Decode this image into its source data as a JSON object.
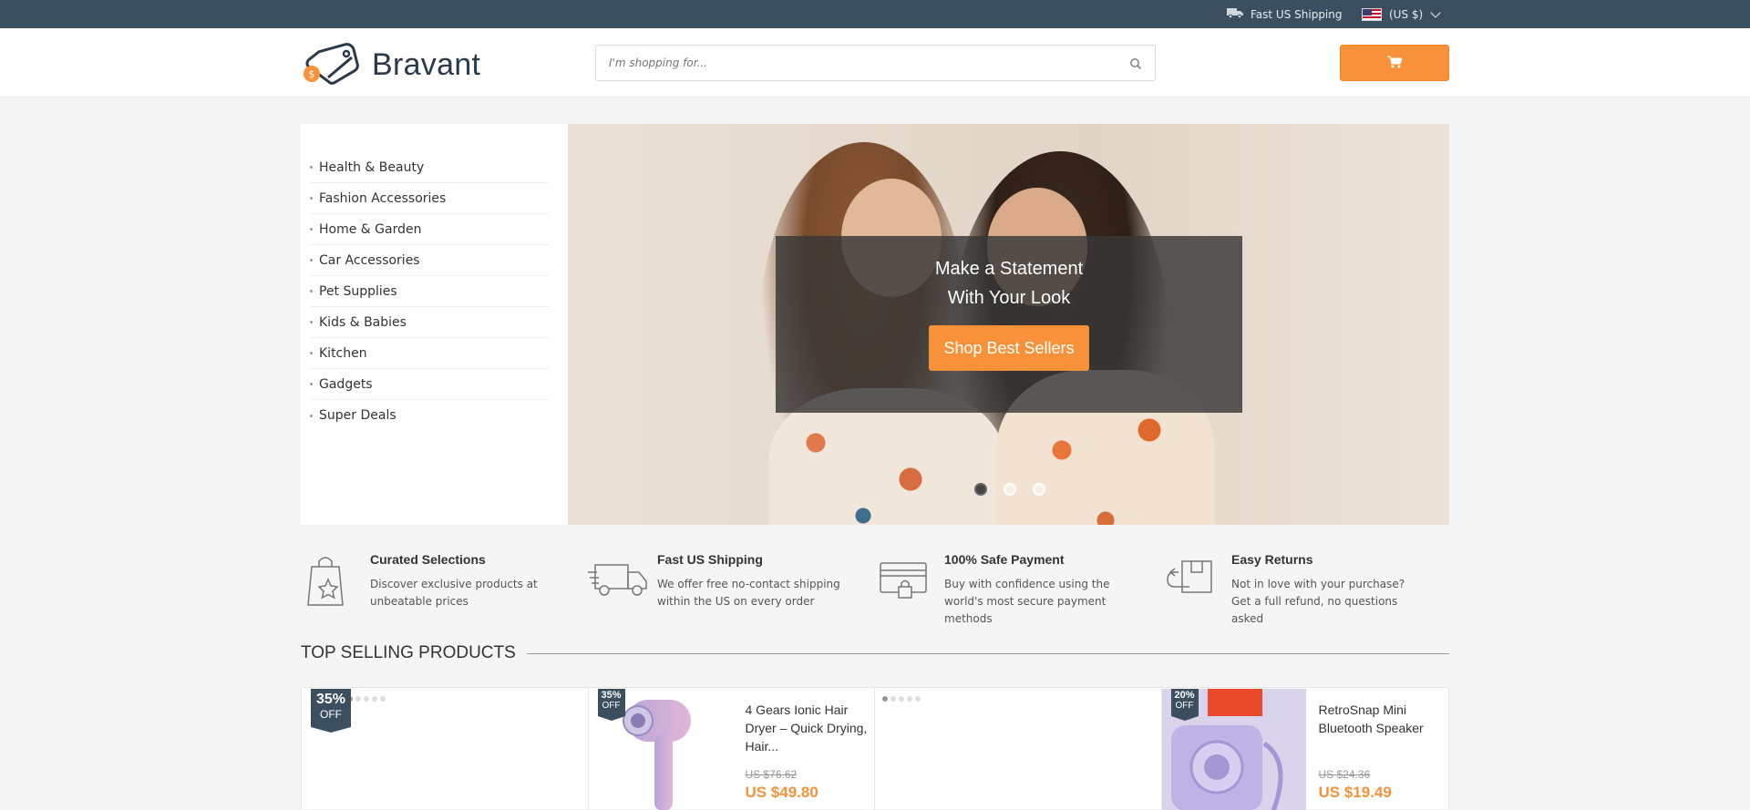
{
  "topbar": {
    "shipping_label": "Fast US Shipping",
    "currency_label": "(US $)"
  },
  "header": {
    "logo_text": "Bravant",
    "search_placeholder": "I'm shopping for...",
    "accent_color": "#f7923a"
  },
  "categories": [
    "Health & Beauty",
    "Fashion Accessories",
    "Home & Garden",
    "Car Accessories",
    "Pet Supplies",
    "Kids & Babies",
    "Kitchen",
    "Gadgets",
    "Super Deals"
  ],
  "hero": {
    "title_line1": "Make a Statement",
    "title_line2": "With Your Look",
    "button_label": "Shop Best Sellers",
    "active_slide": 1,
    "slide_count": 3
  },
  "features": [
    {
      "title": "Curated Selections",
      "text": "Discover exclusive products at unbeatable prices",
      "icon": "shopping-bag-star-icon"
    },
    {
      "title": "Fast US Shipping",
      "text": "We offer free no-contact shipping within the US on every order",
      "icon": "delivery-truck-icon"
    },
    {
      "title": "100% Safe Payment",
      "text": "Buy with confidence using the world's most secure payment methods",
      "icon": "secure-card-icon"
    },
    {
      "title": "Easy Returns",
      "text": "Not in love with your purchase? Get a full refund, no questions asked",
      "icon": "return-box-icon"
    }
  ],
  "section": {
    "top_selling_title": "TOP SELLING PRODUCTS"
  },
  "products": [
    {
      "badge_pct": "35%",
      "badge_off": "OFF",
      "name": "",
      "old_price": "",
      "new_price": ""
    },
    {
      "badge_pct": "35%",
      "badge_off": "OFF",
      "name": "4 Gears Ionic Hair Dryer – Quick Drying, Hair...",
      "old_price": "US $76.62",
      "new_price": "US $49.80"
    },
    {
      "badge_pct": "",
      "badge_off": "",
      "name": "",
      "old_price": "",
      "new_price": ""
    },
    {
      "badge_pct": "20%",
      "badge_off": "OFF",
      "name": "RetroSnap Mini Bluetooth Speaker",
      "old_price": "US $24.36",
      "new_price": "US $19.49"
    }
  ]
}
